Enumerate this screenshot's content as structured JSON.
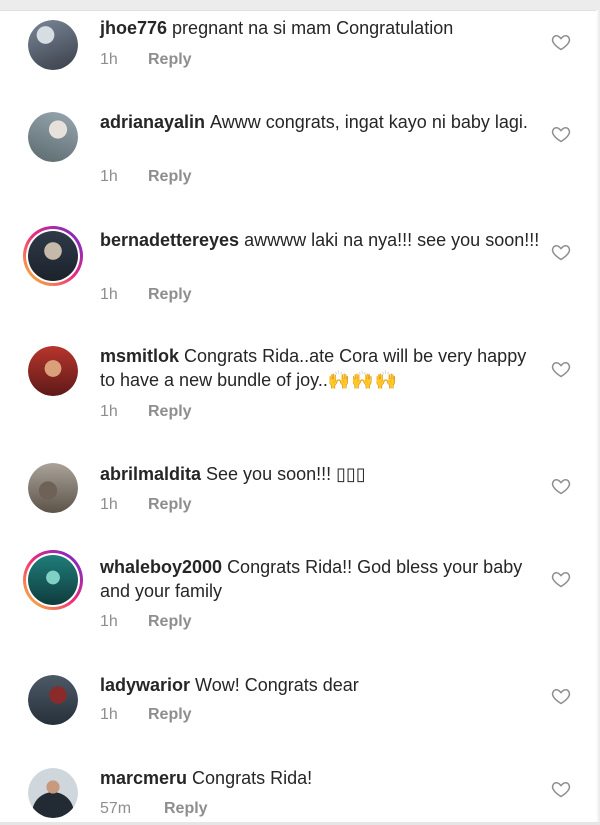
{
  "comments": [
    {
      "username": "jhoe776",
      "text": "pregnant na si mam Congratulation",
      "time": "1h",
      "reply": "Reply",
      "avatar": "avatar-photo",
      "story_ring": false,
      "avatar_colors": [
        "#7a8797",
        "#3a3f4a"
      ]
    },
    {
      "username": "adrianayalin",
      "text": "Awww congrats, ingat kayo ni baby lagi.",
      "time": "1h",
      "reply": "Reply",
      "avatar": "avatar-photo",
      "story_ring": false,
      "avatar_colors": [
        "#9aa7b0",
        "#5a6a6e"
      ]
    },
    {
      "username": "bernadettereyes",
      "text": "awwww laki na nya!!! see you soon!!!",
      "time": "1h",
      "reply": "Reply",
      "avatar": "avatar-photo",
      "story_ring": true,
      "avatar_colors": [
        "#2f3a48",
        "#c7b9a9"
      ]
    },
    {
      "username": "msmitlok",
      "text": "Congrats Rida..ate Cora will be very happy to have a new bundle of joy..",
      "emoji": "🙌🙌🙌",
      "time": "1h",
      "reply": "Reply",
      "avatar": "avatar-photo",
      "story_ring": false,
      "avatar_colors": [
        "#b7352d",
        "#5e1a18"
      ]
    },
    {
      "username": "abrilmaldita",
      "text": "See you soon!!! ▯▯▯",
      "time": "1h",
      "reply": "Reply",
      "avatar": "avatar-photo",
      "story_ring": false,
      "avatar_colors": [
        "#a9a39a",
        "#5d5348"
      ]
    },
    {
      "username": "whaleboy2000",
      "text": "Congrats Rida!! God bless your baby and your family",
      "time": "1h",
      "reply": "Reply",
      "avatar": "avatar-photo",
      "story_ring": true,
      "avatar_colors": [
        "#1f7e7a",
        "#0f3b3d"
      ]
    },
    {
      "username": "ladywarior",
      "text": "Wow! Congrats dear",
      "time": "1h",
      "reply": "Reply",
      "avatar": "avatar-photo",
      "story_ring": false,
      "avatar_colors": [
        "#4c5a66",
        "#8b2a2a"
      ]
    },
    {
      "username": "marcmeru",
      "text": "Congrats Rida!",
      "time": "57m",
      "reply": "Reply",
      "avatar": "avatar-photo",
      "story_ring": false,
      "avatar_colors": [
        "#cfd6dc",
        "#222a33"
      ]
    }
  ],
  "icons": {
    "like": "heart-outline-icon"
  },
  "colors": {
    "text": "#262626",
    "muted": "#8e8e8e",
    "background": "#ffffff"
  }
}
